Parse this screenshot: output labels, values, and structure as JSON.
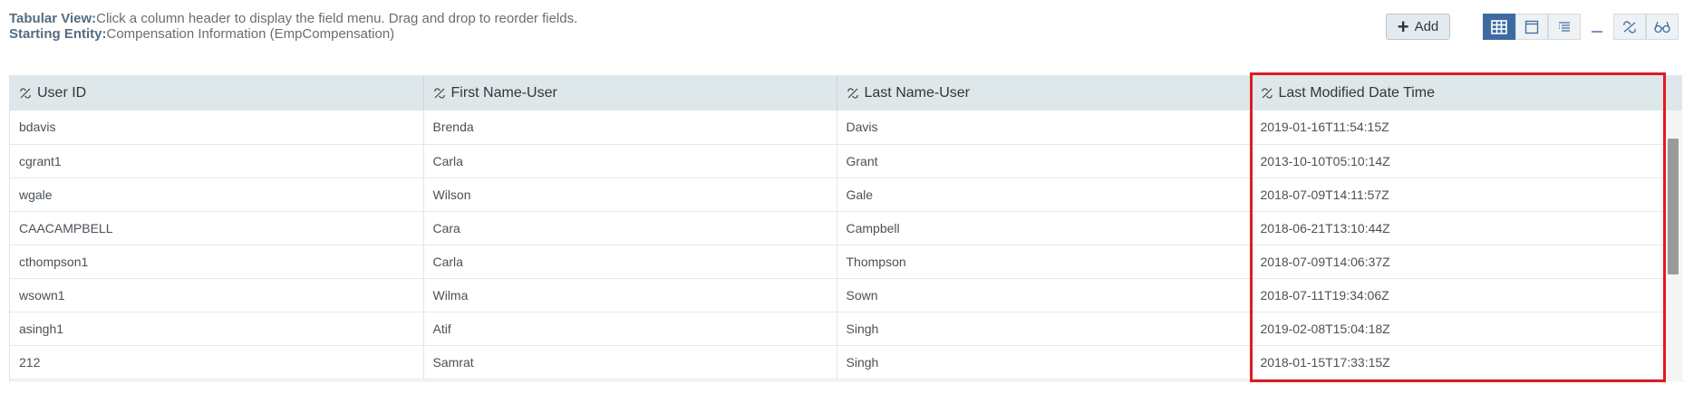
{
  "info": {
    "tabular_label": "Tabular View:",
    "tabular_desc": "Click a column header to display the field menu. Drag and drop to reorder fields.",
    "entity_label": "Starting Entity:",
    "entity_desc": "Compensation Information (EmpCompensation)"
  },
  "toolbar": {
    "add_label": "Add",
    "view_icons": [
      "table-grid-icon",
      "window-icon",
      "list-icon",
      "minimize-icon",
      "unlink-icon",
      "glasses-icon"
    ]
  },
  "table": {
    "columns": [
      "User ID",
      "First Name-User",
      "Last Name-User",
      "Last Modified Date Time"
    ],
    "rows": [
      [
        "bdavis",
        "Brenda",
        "Davis",
        "2019-01-16T11:54:15Z"
      ],
      [
        "cgrant1",
        "Carla",
        "Grant",
        "2013-10-10T05:10:14Z"
      ],
      [
        "wgale",
        "Wilson",
        "Gale",
        "2018-07-09T14:11:57Z"
      ],
      [
        "CAACAMPBELL",
        "Cara",
        "Campbell",
        "2018-06-21T13:10:44Z"
      ],
      [
        "cthompson1",
        "Carla",
        "Thompson",
        "2018-07-09T14:06:37Z"
      ],
      [
        "wsown1",
        "Wilma",
        "Sown",
        "2018-07-11T19:34:06Z"
      ],
      [
        "asingh1",
        "Atif",
        "Singh",
        "2019-02-08T15:04:18Z"
      ],
      [
        "212",
        "Samrat",
        "Singh",
        "2018-01-15T17:33:15Z"
      ]
    ]
  },
  "colors": {
    "header_bg": "#dee7e9",
    "accent": "#3e6aa1",
    "highlight": "#e11b22"
  }
}
